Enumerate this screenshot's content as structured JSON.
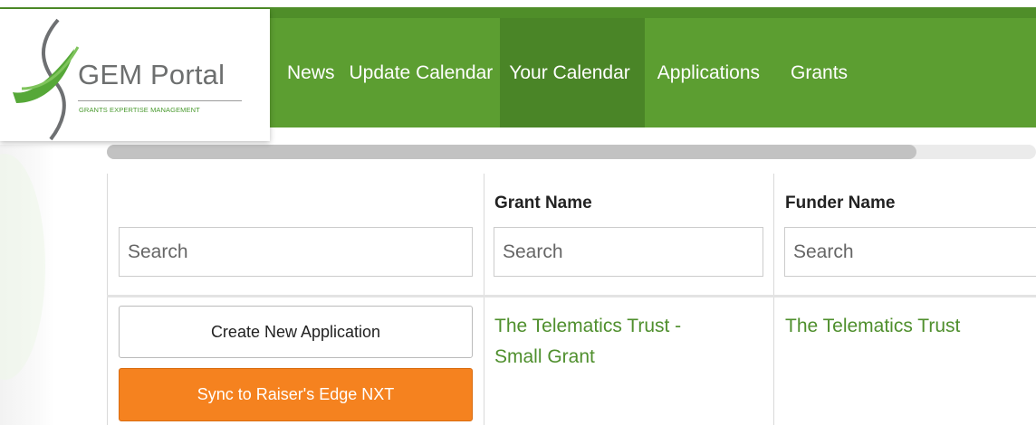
{
  "logo": {
    "title": "GEM Portal",
    "subtitle": "GRANTS EXPERTISE MANAGEMENT",
    "icon": "gem-swoosh-logo"
  },
  "nav": {
    "items": [
      {
        "label": "News",
        "active": false
      },
      {
        "label": "Update Calendar",
        "active": false
      },
      {
        "label": "Your Calendar",
        "active": true
      },
      {
        "label": "Applications",
        "active": false
      },
      {
        "label": "Grants",
        "active": false
      }
    ]
  },
  "colors": {
    "nav_green": "#5c9e31",
    "nav_active": "#4a8527",
    "link_green": "#4f8f2d",
    "sync_orange": "#f5821f"
  },
  "table": {
    "columns": [
      {
        "header": "",
        "search_placeholder": "Search"
      },
      {
        "header": "Grant Name",
        "search_placeholder": "Search"
      },
      {
        "header": "Funder Name",
        "search_placeholder": "Search"
      }
    ],
    "rows": [
      {
        "actions": {
          "create_label": "Create New Application",
          "sync_label": "Sync to Raiser's Edge NXT"
        },
        "grant_name_line1": "The Telematics Trust -",
        "grant_name_line2": "Small Grant",
        "funder_name": "The Telematics Trust"
      }
    ]
  }
}
